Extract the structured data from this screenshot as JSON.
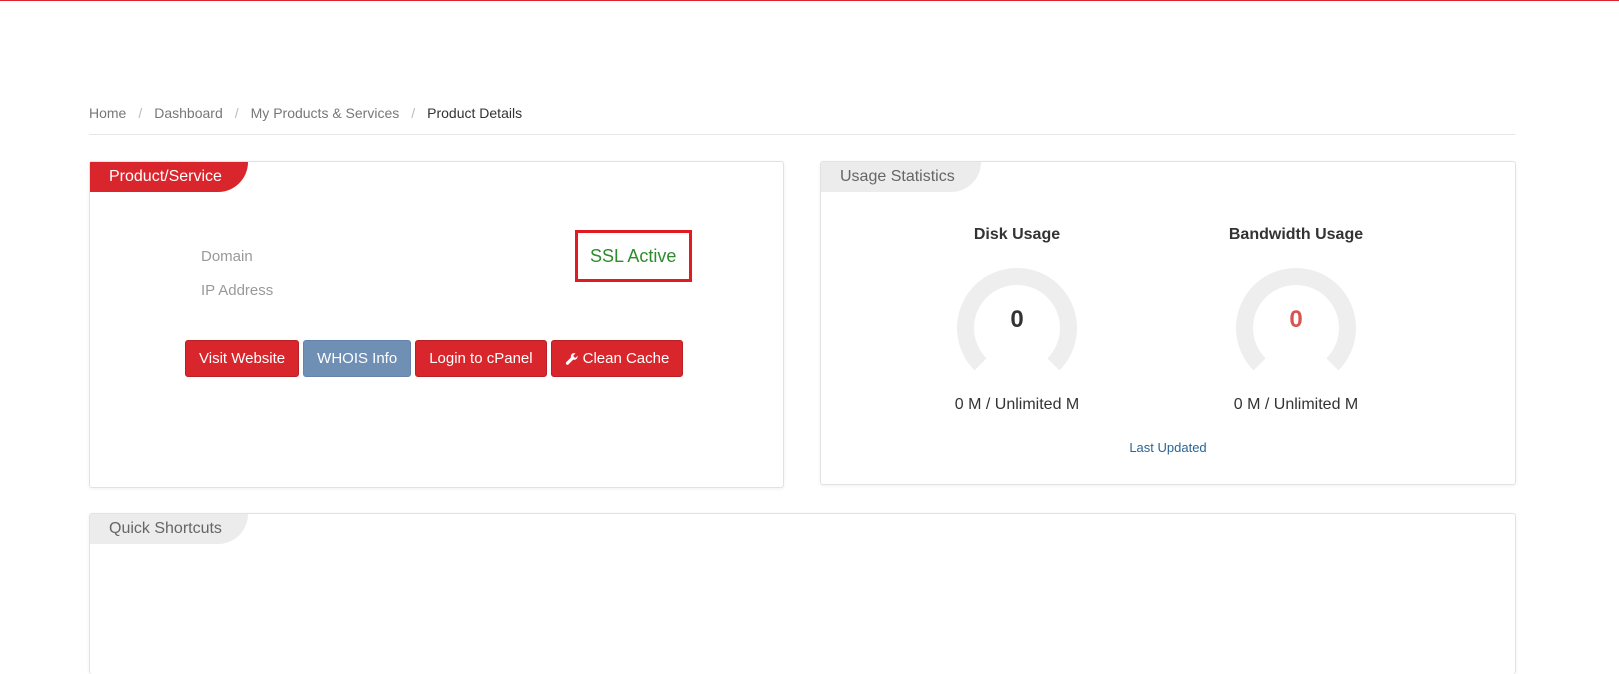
{
  "breadcrumb": {
    "items": [
      "Home",
      "Dashboard",
      "My Products & Services"
    ],
    "active": "Product Details",
    "separator": "/"
  },
  "product_panel": {
    "title": "Product/Service",
    "domain_label": "Domain",
    "ip_label": "IP Address",
    "ssl_status": "SSL Active",
    "buttons": {
      "visit": "Visit Website",
      "whois": "WHOIS Info",
      "cpanel": "Login to cPanel",
      "cache": "Clean Cache"
    }
  },
  "usage_panel": {
    "title": "Usage Statistics",
    "disk": {
      "title": "Disk Usage",
      "value": "0",
      "caption": "0 M / Unlimited M",
      "color": "#333333"
    },
    "bandwidth": {
      "title": "Bandwidth Usage",
      "value": "0",
      "caption": "0 M / Unlimited M",
      "color": "#d9534f"
    },
    "last_updated": "Last Updated"
  },
  "shortcuts_panel": {
    "title": "Quick Shortcuts"
  },
  "colors": {
    "brand_red": "#d9262c",
    "ssl_green": "#2e8b2e",
    "whois_blue": "#6f8fb4",
    "gauge_track": "#eeeeee"
  }
}
